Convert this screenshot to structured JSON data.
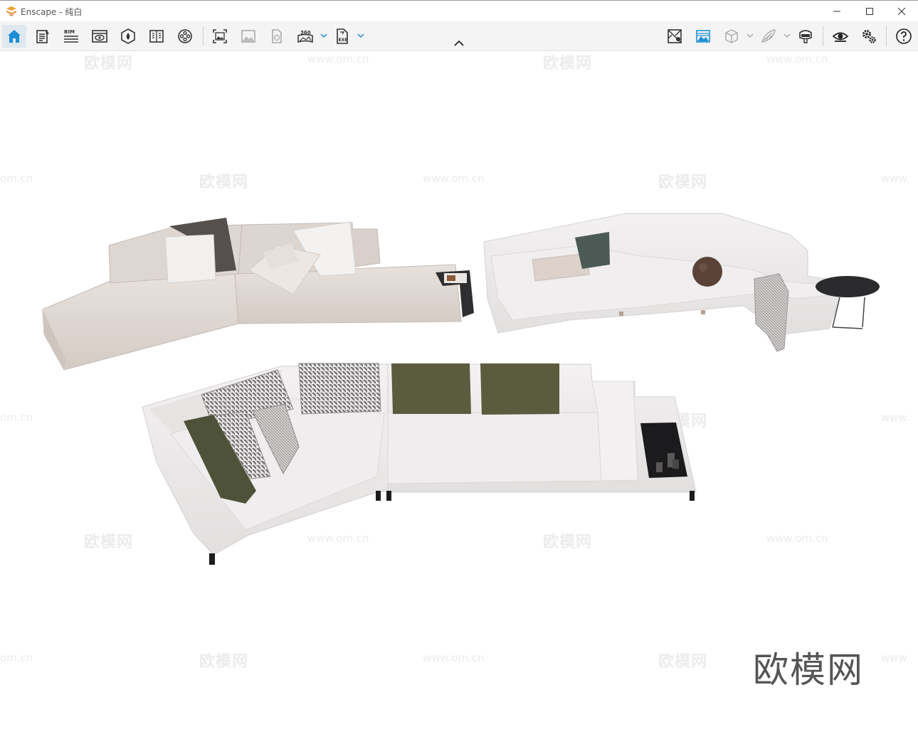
{
  "window": {
    "title": "Enscape - 纯白",
    "controls": [
      "minimize",
      "maximize",
      "close"
    ]
  },
  "toolbar": {
    "left_icons": [
      "home-icon",
      "notes-icon",
      "bim-icon",
      "visibility-icon",
      "asset-library-icon",
      "book-icon",
      "video-editor-icon",
      "screenshot-icon",
      "batch-render-icon",
      "panorama-icon",
      "panorama-360-icon",
      "export-exe-icon"
    ],
    "right_icons": [
      "map-icon",
      "sky-icon",
      "cube-icon",
      "material-icon",
      "vr-headset-icon",
      "eye-icon",
      "settings-icon",
      "help-icon"
    ],
    "bim_label": "BIM",
    "pano_label": "360",
    "exe_label": "EXE",
    "active_icon": "home-icon",
    "accent_color": "#1e8fd6"
  },
  "viewport": {
    "watermark_cn": "欧模网",
    "watermark_url": "www.om.cn",
    "watermark_url_partial": "om.cn",
    "watermark_url_cut": "www.",
    "brand_logo": "欧模网"
  }
}
